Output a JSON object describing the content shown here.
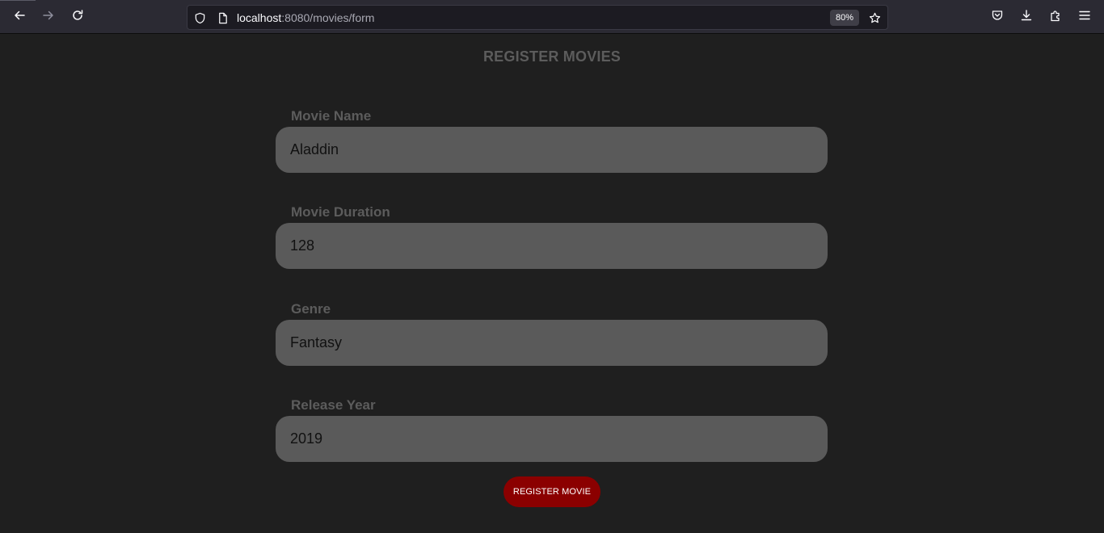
{
  "browser": {
    "url_host": "localhost",
    "url_path": ":8080/movies/form",
    "zoom": "80%",
    "icons": [
      "back-arrow-icon",
      "forward-arrow-icon",
      "reload-icon",
      "shield-icon",
      "page-icon",
      "star-icon",
      "pocket-icon",
      "download-icon",
      "extensions-icon",
      "menu-icon"
    ]
  },
  "form": {
    "title": "REGISTER MOVIES",
    "fields": [
      {
        "label": "Movie Name",
        "value": "Aladdin"
      },
      {
        "label": "Movie Duration",
        "value": "128"
      },
      {
        "label": "Genre",
        "value": "Fantasy"
      },
      {
        "label": "Release Year",
        "value": "2019"
      }
    ],
    "submit_label": "REGISTER MOVIE"
  },
  "colors": {
    "page_background": "#1f1f1f",
    "input_background": "#5a5a5a",
    "label_color": "#5c5c5c",
    "button_background": "#8b0000"
  }
}
